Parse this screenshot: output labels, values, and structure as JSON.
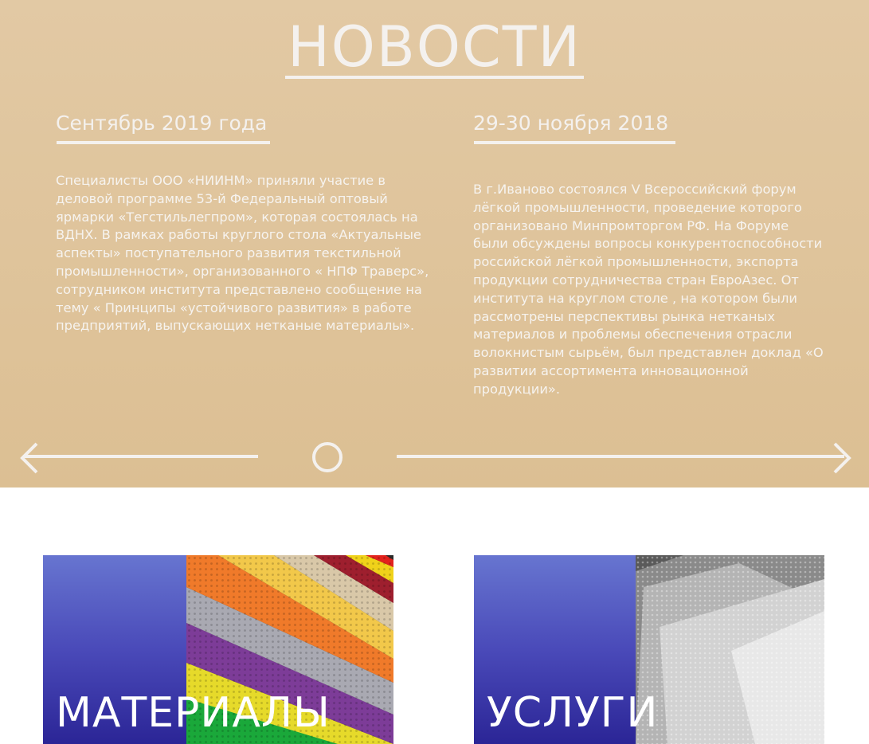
{
  "news": {
    "title": "НОВОСТИ",
    "items": [
      {
        "date": "Сентябрь 2019 года",
        "text": "Специалисты ООО «НИИНМ» приняли участие в деловой программе 53-й Федеральный оптовый ярмарки «Тегстильлегпром», которая состоялась на ВДНХ. В рамках работы круглого стола «Актуальные аспекты» поступательного развития текстильной промышленности», организованного « НПФ Траверс», сотрудником института представлено сообщение на тему « Принципы «устойчивого развития» в работе предприятий, выпускающих нетканые материалы»."
      },
      {
        "date": "29-30 ноября 2018",
        "text": "В г.Иваново состоялся V Всероссийский форум лёгкой промышленности, проведение которого организовано Минпромторгом РФ. На Форуме были обсуждены вопросы конкурентоспособности российской лёгкой промышленности, экспорта продукции сотрудничества стран ЕвроАзес. От института на круглом столе , на котором были рассмотрены перспективы рынка нетканых материалов и проблемы обеспечения отрасли волокнистым сырьём, был представлен доклад «О развитии ассортимента инновационной продукции»."
      }
    ]
  },
  "cards": [
    {
      "label": "МАТЕРИАЛЫ"
    },
    {
      "label": "УСЛУГИ"
    }
  ],
  "colors": {
    "news_background": "#dfc49b",
    "news_text": "#f4f1ee",
    "card_blue_top": "#6775d0",
    "card_blue_bottom": "#2b2596"
  },
  "icons": {
    "prev": "arrow-left-icon",
    "next": "arrow-right-icon",
    "slider": "circle-indicator-icon"
  }
}
